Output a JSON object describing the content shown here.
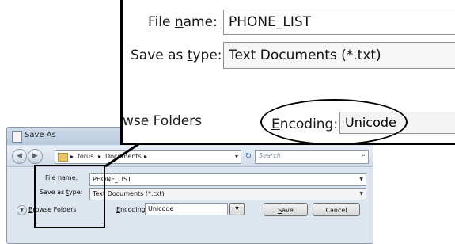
{
  "dialog": {
    "title": "Save As",
    "nav": {
      "back_icon": "back-arrow-icon",
      "forward_icon": "forward-arrow-icon"
    },
    "address": {
      "crumbs": [
        "forus",
        "Documents"
      ],
      "separator": "▸"
    },
    "search": {
      "placeholder": "Search"
    },
    "file_name_label_pre": "File ",
    "file_name_label_u": "n",
    "file_name_label_post": "ame:",
    "file_name": "PHONE_LIST",
    "save_type_label_pre": "Save as ",
    "save_type_label_u": "t",
    "save_type_label_post": "ype:",
    "save_type": "Text Documents (*.txt)",
    "browse_label_u": "B",
    "browse_label_post": "rowse Folders",
    "encoding_label_pre": "",
    "encoding_label_u": "E",
    "encoding_label_post": "ncoding:",
    "encoding": "Unicode",
    "save_button_u": "S",
    "save_button_post": "ave",
    "cancel_button": "Cancel"
  },
  "zoom": {
    "file_name_label_pre": "File ",
    "file_name_label_u": "n",
    "file_name_label_post": "ame:",
    "file_name": "PHONE_LIST",
    "save_type_label_pre": "Save as ",
    "save_type_label_u": "t",
    "save_type_label_post": "ype:",
    "save_type": "Text Documents (*.txt)",
    "browse_fragment": "wse Folders",
    "encoding_label_u": "E",
    "encoding_label_post": "ncoding:",
    "encoding": "Unicode"
  },
  "colors": {
    "dialog_bg": "#dde5ee",
    "highlight": "#000000"
  }
}
